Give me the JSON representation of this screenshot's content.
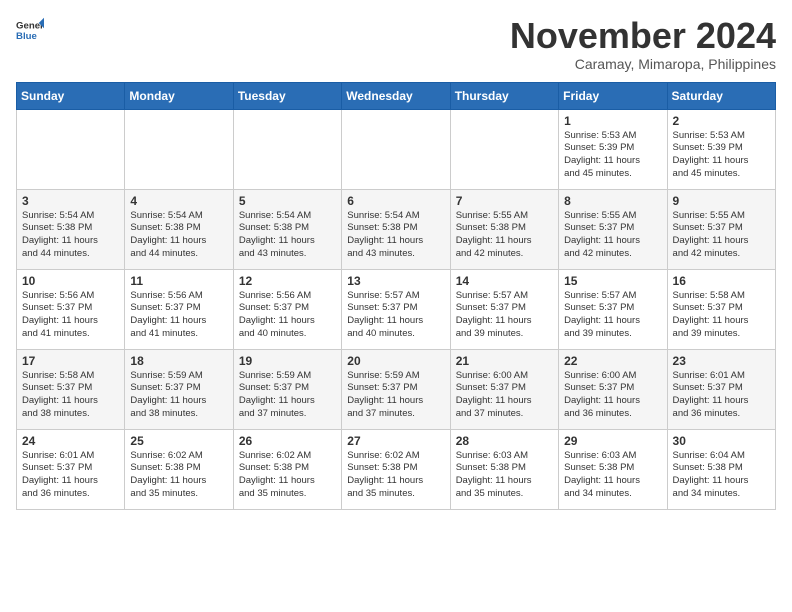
{
  "header": {
    "logo_general": "General",
    "logo_blue": "Blue",
    "month_title": "November 2024",
    "location": "Caramay, Mimaropa, Philippines"
  },
  "weekdays": [
    "Sunday",
    "Monday",
    "Tuesday",
    "Wednesday",
    "Thursday",
    "Friday",
    "Saturday"
  ],
  "weeks": [
    [
      {
        "day": "",
        "info": ""
      },
      {
        "day": "",
        "info": ""
      },
      {
        "day": "",
        "info": ""
      },
      {
        "day": "",
        "info": ""
      },
      {
        "day": "",
        "info": ""
      },
      {
        "day": "1",
        "info": "Sunrise: 5:53 AM\nSunset: 5:39 PM\nDaylight: 11 hours\nand 45 minutes."
      },
      {
        "day": "2",
        "info": "Sunrise: 5:53 AM\nSunset: 5:39 PM\nDaylight: 11 hours\nand 45 minutes."
      }
    ],
    [
      {
        "day": "3",
        "info": "Sunrise: 5:54 AM\nSunset: 5:38 PM\nDaylight: 11 hours\nand 44 minutes."
      },
      {
        "day": "4",
        "info": "Sunrise: 5:54 AM\nSunset: 5:38 PM\nDaylight: 11 hours\nand 44 minutes."
      },
      {
        "day": "5",
        "info": "Sunrise: 5:54 AM\nSunset: 5:38 PM\nDaylight: 11 hours\nand 43 minutes."
      },
      {
        "day": "6",
        "info": "Sunrise: 5:54 AM\nSunset: 5:38 PM\nDaylight: 11 hours\nand 43 minutes."
      },
      {
        "day": "7",
        "info": "Sunrise: 5:55 AM\nSunset: 5:38 PM\nDaylight: 11 hours\nand 42 minutes."
      },
      {
        "day": "8",
        "info": "Sunrise: 5:55 AM\nSunset: 5:37 PM\nDaylight: 11 hours\nand 42 minutes."
      },
      {
        "day": "9",
        "info": "Sunrise: 5:55 AM\nSunset: 5:37 PM\nDaylight: 11 hours\nand 42 minutes."
      }
    ],
    [
      {
        "day": "10",
        "info": "Sunrise: 5:56 AM\nSunset: 5:37 PM\nDaylight: 11 hours\nand 41 minutes."
      },
      {
        "day": "11",
        "info": "Sunrise: 5:56 AM\nSunset: 5:37 PM\nDaylight: 11 hours\nand 41 minutes."
      },
      {
        "day": "12",
        "info": "Sunrise: 5:56 AM\nSunset: 5:37 PM\nDaylight: 11 hours\nand 40 minutes."
      },
      {
        "day": "13",
        "info": "Sunrise: 5:57 AM\nSunset: 5:37 PM\nDaylight: 11 hours\nand 40 minutes."
      },
      {
        "day": "14",
        "info": "Sunrise: 5:57 AM\nSunset: 5:37 PM\nDaylight: 11 hours\nand 39 minutes."
      },
      {
        "day": "15",
        "info": "Sunrise: 5:57 AM\nSunset: 5:37 PM\nDaylight: 11 hours\nand 39 minutes."
      },
      {
        "day": "16",
        "info": "Sunrise: 5:58 AM\nSunset: 5:37 PM\nDaylight: 11 hours\nand 39 minutes."
      }
    ],
    [
      {
        "day": "17",
        "info": "Sunrise: 5:58 AM\nSunset: 5:37 PM\nDaylight: 11 hours\nand 38 minutes."
      },
      {
        "day": "18",
        "info": "Sunrise: 5:59 AM\nSunset: 5:37 PM\nDaylight: 11 hours\nand 38 minutes."
      },
      {
        "day": "19",
        "info": "Sunrise: 5:59 AM\nSunset: 5:37 PM\nDaylight: 11 hours\nand 37 minutes."
      },
      {
        "day": "20",
        "info": "Sunrise: 5:59 AM\nSunset: 5:37 PM\nDaylight: 11 hours\nand 37 minutes."
      },
      {
        "day": "21",
        "info": "Sunrise: 6:00 AM\nSunset: 5:37 PM\nDaylight: 11 hours\nand 37 minutes."
      },
      {
        "day": "22",
        "info": "Sunrise: 6:00 AM\nSunset: 5:37 PM\nDaylight: 11 hours\nand 36 minutes."
      },
      {
        "day": "23",
        "info": "Sunrise: 6:01 AM\nSunset: 5:37 PM\nDaylight: 11 hours\nand 36 minutes."
      }
    ],
    [
      {
        "day": "24",
        "info": "Sunrise: 6:01 AM\nSunset: 5:37 PM\nDaylight: 11 hours\nand 36 minutes."
      },
      {
        "day": "25",
        "info": "Sunrise: 6:02 AM\nSunset: 5:38 PM\nDaylight: 11 hours\nand 35 minutes."
      },
      {
        "day": "26",
        "info": "Sunrise: 6:02 AM\nSunset: 5:38 PM\nDaylight: 11 hours\nand 35 minutes."
      },
      {
        "day": "27",
        "info": "Sunrise: 6:02 AM\nSunset: 5:38 PM\nDaylight: 11 hours\nand 35 minutes."
      },
      {
        "day": "28",
        "info": "Sunrise: 6:03 AM\nSunset: 5:38 PM\nDaylight: 11 hours\nand 35 minutes."
      },
      {
        "day": "29",
        "info": "Sunrise: 6:03 AM\nSunset: 5:38 PM\nDaylight: 11 hours\nand 34 minutes."
      },
      {
        "day": "30",
        "info": "Sunrise: 6:04 AM\nSunset: 5:38 PM\nDaylight: 11 hours\nand 34 minutes."
      }
    ]
  ]
}
